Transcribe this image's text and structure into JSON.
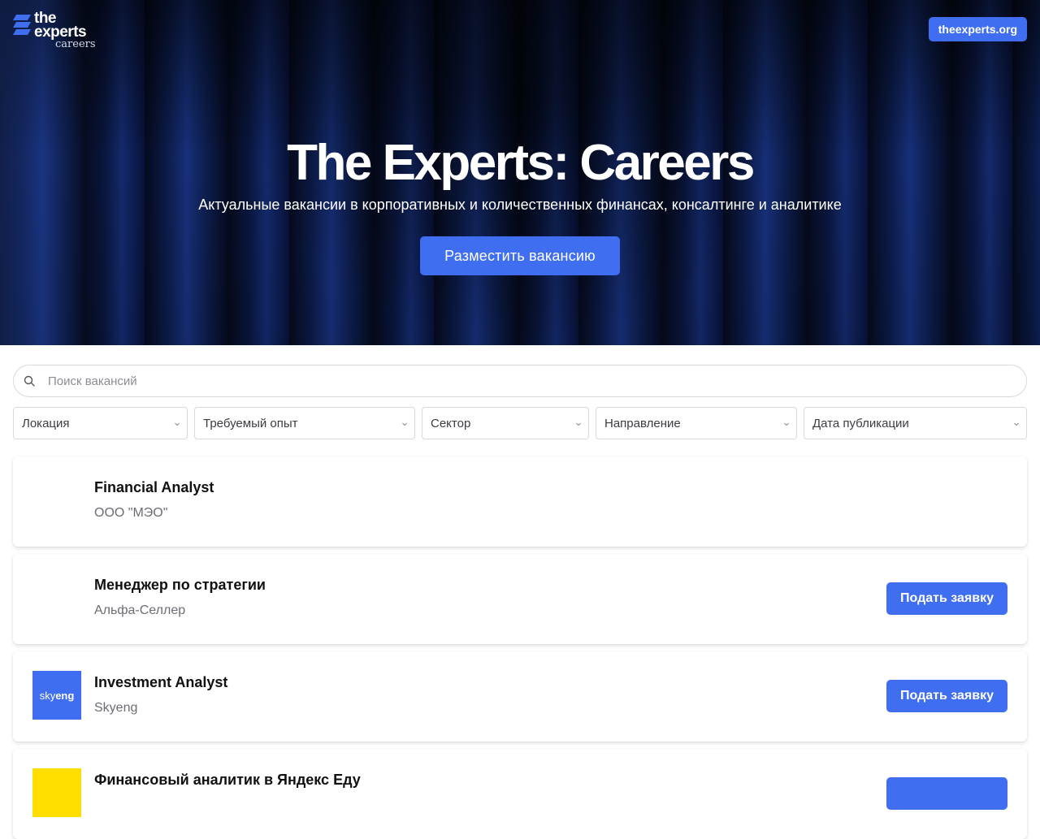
{
  "header": {
    "logo_line1": "the",
    "logo_line2": "experts",
    "logo_line3": "careers",
    "external_link": "theexperts.org"
  },
  "hero": {
    "title": "The Experts: Careers",
    "subtitle": "Актуальные вакансии в корпоративных и количественных финансах, консалтинге и аналитике",
    "cta_label": "Разместить вакансию"
  },
  "search": {
    "placeholder": "Поиск вакансий",
    "value": ""
  },
  "filters": [
    {
      "label": "Локация"
    },
    {
      "label": "Требуемый опыт"
    },
    {
      "label": "Сектор"
    },
    {
      "label": "Направление"
    },
    {
      "label": "Дата публикации"
    }
  ],
  "jobs": [
    {
      "title": "Financial Analyst",
      "company": "ООО \"МЭО\"",
      "apply_label": ""
    },
    {
      "title": "Менеджер по стратегии",
      "company": "Альфа-Селлер",
      "apply_label": "Подать заявку"
    },
    {
      "title": "Investment Analyst",
      "company": "Skyeng",
      "apply_label": "Подать заявку",
      "logo_text_light": "sky",
      "logo_text_bold": "eng"
    },
    {
      "title": "Финансовый аналитик в Яндекс Еду",
      "company": "",
      "apply_label": ""
    }
  ],
  "colors": {
    "accent": "#3f6ff0",
    "hero_bg": "#0b1638",
    "yandex_logo": "#ffde00"
  }
}
